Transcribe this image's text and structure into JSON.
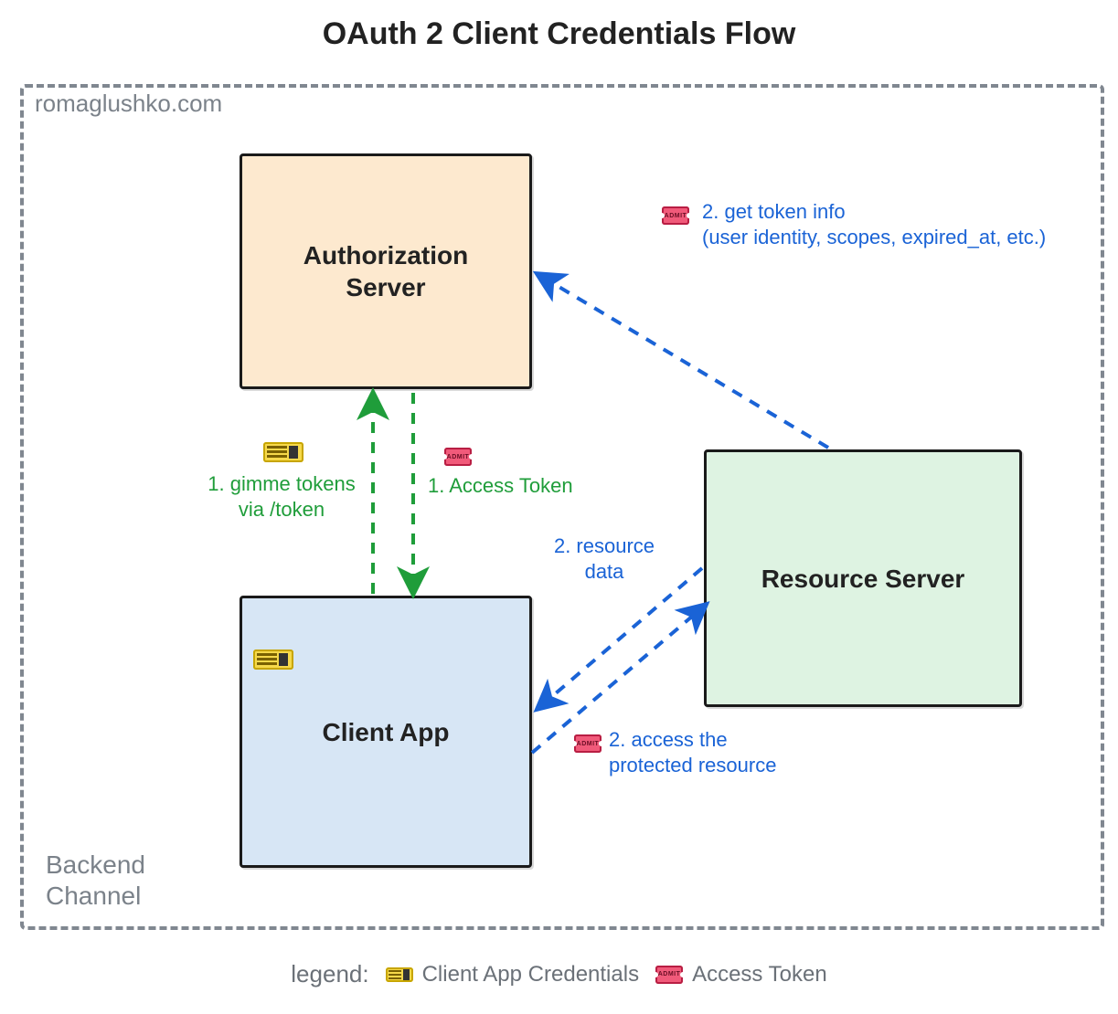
{
  "title": "OAuth 2 Client Credentials Flow",
  "watermark": "romaglushko.com",
  "channel_label": "Backend\nChannel",
  "nodes": {
    "auth_server": {
      "label": "Authorization\nServer",
      "fill": "#fde9cf"
    },
    "client_app": {
      "label": "Client App",
      "fill": "#d7e6f5"
    },
    "res_server": {
      "label": "Resource Server",
      "fill": "#def3e2"
    }
  },
  "edges": {
    "req_token": {
      "label": "1. gimme tokens\nvia /token",
      "icon": "ticket",
      "color": "green"
    },
    "resp_token": {
      "label": "1. Access Token",
      "icon": "token",
      "color": "green"
    },
    "token_info": {
      "label": "2. get token info\n(user identity, scopes, expired_at, etc.)",
      "icon": "token",
      "color": "blue"
    },
    "resource_data": {
      "label": "2. resource\ndata",
      "color": "blue"
    },
    "access_protected": {
      "label": "2. access the\nprotected resource",
      "icon": "token",
      "color": "blue"
    }
  },
  "legend": {
    "label": "legend:",
    "items": [
      {
        "icon": "ticket",
        "text": "Client App Credentials"
      },
      {
        "icon": "token",
        "text": "Access Token"
      }
    ]
  },
  "icons": {
    "ticket": {
      "semantic": "concert-ticket-icon (client credentials)"
    },
    "token": {
      "semantic": "admit-one-ticket-icon (access token)",
      "word": "ADMIT"
    }
  },
  "colors": {
    "green": "#1f9d3a",
    "blue": "#1a63d6",
    "gray": "#808790",
    "black": "#1a1a1a"
  }
}
